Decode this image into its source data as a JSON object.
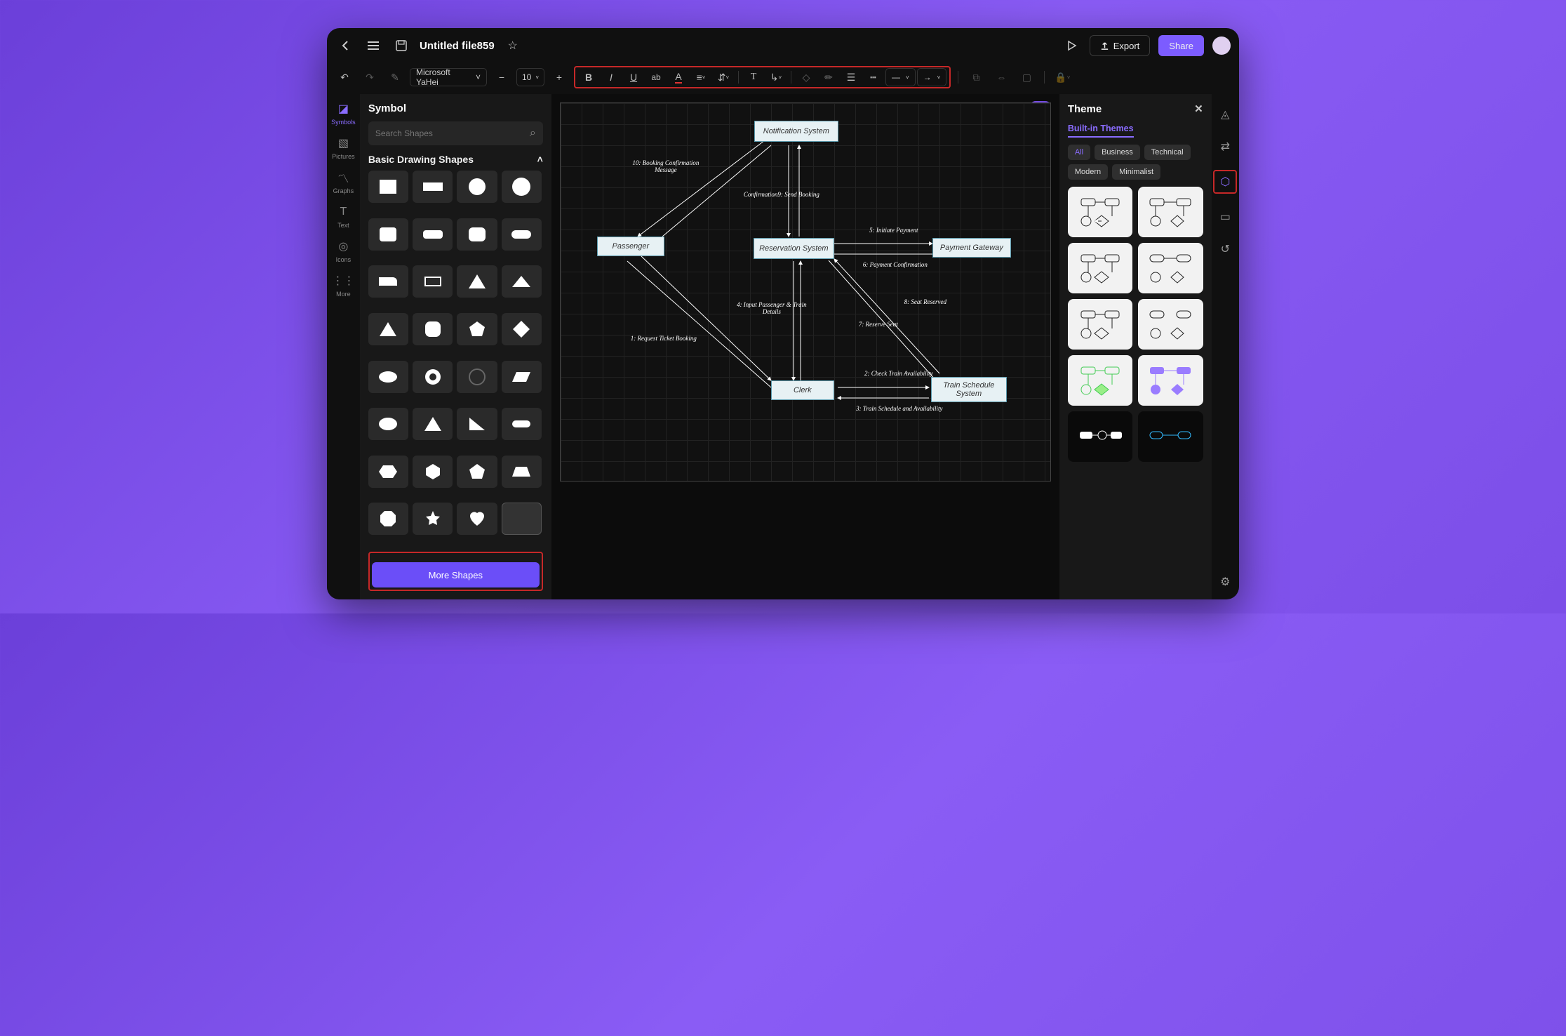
{
  "titlebar": {
    "file_name": "Untitled file859",
    "export_label": "Export",
    "share_label": "Share"
  },
  "format_bar": {
    "font_family": "Microsoft YaHei",
    "font_size": "10"
  },
  "left_rail": {
    "items": [
      {
        "label": "Symbols",
        "icon": "symbols-icon",
        "active": true
      },
      {
        "label": "Pictures",
        "icon": "pictures-icon",
        "active": false
      },
      {
        "label": "Graphs",
        "icon": "graphs-icon",
        "active": false
      },
      {
        "label": "Text",
        "icon": "text-icon",
        "active": false
      },
      {
        "label": "Icons",
        "icon": "icons-icon",
        "active": false
      },
      {
        "label": "More",
        "icon": "more-icon",
        "active": false
      }
    ]
  },
  "symbol_panel": {
    "title": "Symbol",
    "search_placeholder": "Search Shapes",
    "section_title": "Basic Drawing Shapes",
    "more_shapes_label": "More Shapes"
  },
  "canvas": {
    "nodes": {
      "notification": "Notification System",
      "passenger": "Passenger",
      "reservation": "Reservation System",
      "payment": "Payment Gateway",
      "clerk": "Clerk",
      "schedule": "Train Schedule System"
    },
    "labels": {
      "l10": "10: Booking Confirmation Message",
      "l9": "Confirmation9: Send Booking",
      "l5": "5: Initiate Payment",
      "l6": "6: Payment Confirmation",
      "l4": "4: Input Passenger & Train Details",
      "l8": "8: Seat Reserved",
      "l7": "7: Reserve Seat",
      "l1": "1: Request Ticket Booking",
      "l2": "2: Check Train Availability",
      "l3": "3: Train Schedule and Availability"
    }
  },
  "theme_panel": {
    "title": "Theme",
    "tab_label": "Built-in Themes",
    "filters": [
      "All",
      "Business",
      "Technical",
      "Modern",
      "Minimalist"
    ],
    "active_filter": "All"
  }
}
